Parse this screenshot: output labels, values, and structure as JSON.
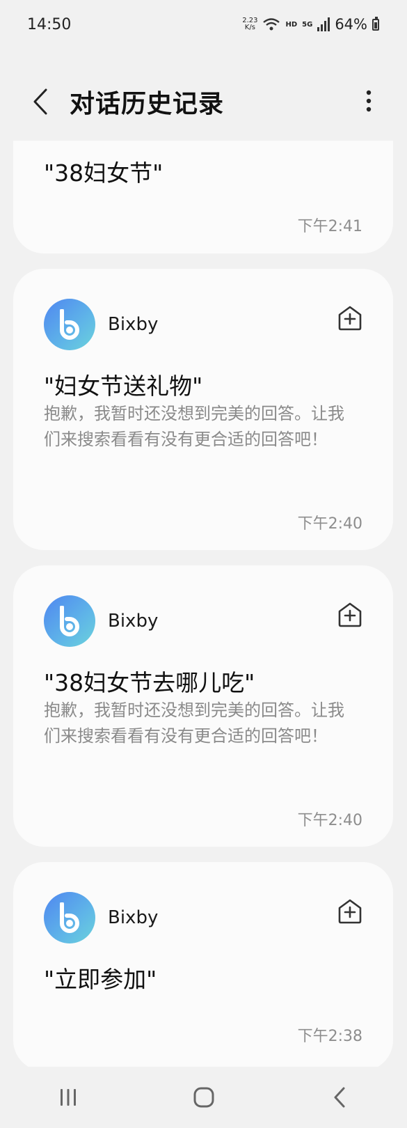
{
  "status": {
    "time": "14:50",
    "net_speed_value": "2.23",
    "net_speed_unit": "K/s",
    "hd": "HD",
    "network": "5G",
    "battery_pct": "64%",
    "battery_level": 0.64
  },
  "app_bar": {
    "title": "对话历史记录",
    "back_icon": "chevron-left-icon",
    "more_icon": "more-vert-icon"
  },
  "history": {
    "partial_top": {
      "query": "\"38妇女节\"",
      "time": "下午2:41"
    },
    "items": [
      {
        "assistant": "Bixby",
        "query": "\"妇女节送礼物\"",
        "reply": "抱歉，我暂时还没想到完美的回答。让我们来搜索看看有没有更合适的回答吧！",
        "time": "下午2:40"
      },
      {
        "assistant": "Bixby",
        "query": "\"38妇女节去哪儿吃\"",
        "reply": "抱歉，我暂时还没想到完美的回答。让我们来搜索看看有没有更合适的回答吧！",
        "time": "下午2:40"
      },
      {
        "assistant": "Bixby",
        "query": "\"立即参加\"",
        "time": "下午2:38"
      }
    ]
  },
  "nav_bar": {
    "recents_icon": "recents-icon",
    "home_icon": "home-icon",
    "back_icon": "back-icon"
  }
}
